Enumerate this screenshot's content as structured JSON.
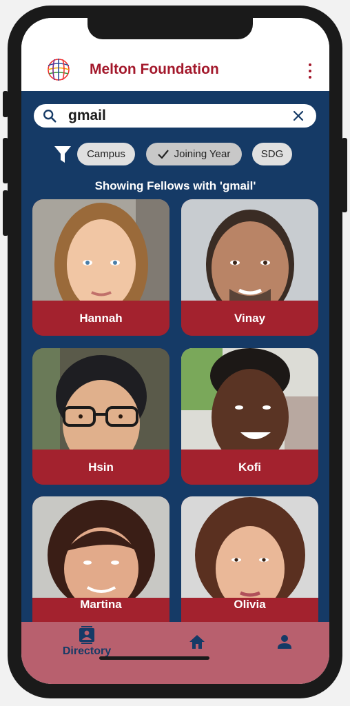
{
  "app": {
    "title": "Melton Foundation",
    "menu_icon": "more-vert-icon",
    "brand_color": "#a3182b",
    "navy": "#153a66"
  },
  "search": {
    "value": "gmail",
    "search_icon": "search-icon",
    "clear_icon": "close-icon"
  },
  "filters": {
    "icon": "filter-icon",
    "chips": [
      {
        "label": "Campus",
        "selected": false
      },
      {
        "label": "Joining Year",
        "selected": true
      },
      {
        "label": "SDG",
        "selected": false
      }
    ]
  },
  "results_heading": "Showing Fellows with 'gmail'",
  "fellows": [
    {
      "name": "Hannah"
    },
    {
      "name": "Vinay"
    },
    {
      "name": "Hsin"
    },
    {
      "name": "Kofi"
    },
    {
      "name": "Martina"
    },
    {
      "name": "Olivia"
    }
  ],
  "bottom_nav": {
    "items": [
      {
        "label": "Directory",
        "icon": "contacts-icon",
        "active": true
      },
      {
        "label": "",
        "icon": "home-icon",
        "active": false
      },
      {
        "label": "",
        "icon": "person-icon",
        "active": false
      }
    ]
  }
}
